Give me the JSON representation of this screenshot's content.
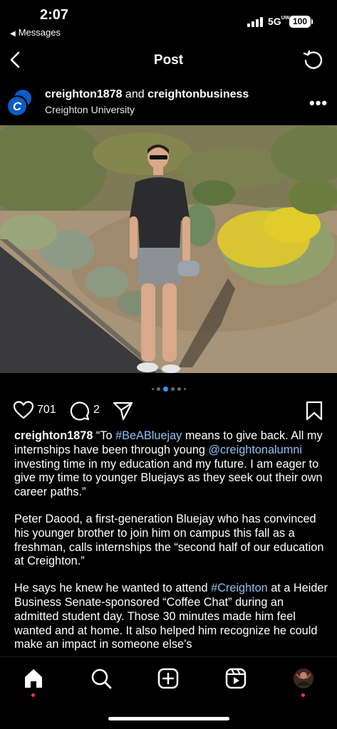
{
  "status_bar": {
    "time": "2:07",
    "back_app": "Messages",
    "network": "5G",
    "network_sup": "UW",
    "battery": "100"
  },
  "nav": {
    "title": "Post"
  },
  "post": {
    "author_primary": "creighton1878",
    "author_join": " and ",
    "author_secondary": "creightonbusiness",
    "subtitle": "Creighton University",
    "likes": "701",
    "comments": "2",
    "carousel": {
      "count": 6,
      "active_index": 2
    },
    "caption": {
      "username": "creighton1878",
      "p1_a": " “To ",
      "p1_tag1": "#BeABluejay",
      "p1_b": " means to give back. All my internships have been through young ",
      "p1_tag2": "@creightonalumni",
      "p1_c": " investing time in my education and my future. I am eager to give my time to younger Bluejays as they seek out their own career paths.”",
      "p2": "Peter Daood, a first-generation Bluejay who has convinced his younger brother to join him on campus this fall as a freshman, calls internships the “second half of our education at Creighton.”",
      "p3_a": "He says he knew he wanted to attend ",
      "p3_tag": "#Creighton",
      "p3_b": " at a Heider Business Senate-sponsored “Coffee Chat” during an admitted student day. Those 30 minutes made him feel wanted and at home. It also helped him recognize he could make an impact in someone else’s"
    }
  },
  "colors": {
    "link": "#8fc1f2",
    "accent_dot": "#3d8fff",
    "notification": "#ff3040",
    "creighton_blue": "#0a5dc2"
  },
  "tabs": [
    "home-icon",
    "search-icon",
    "create-icon",
    "reels-icon",
    "profile-avatar"
  ]
}
